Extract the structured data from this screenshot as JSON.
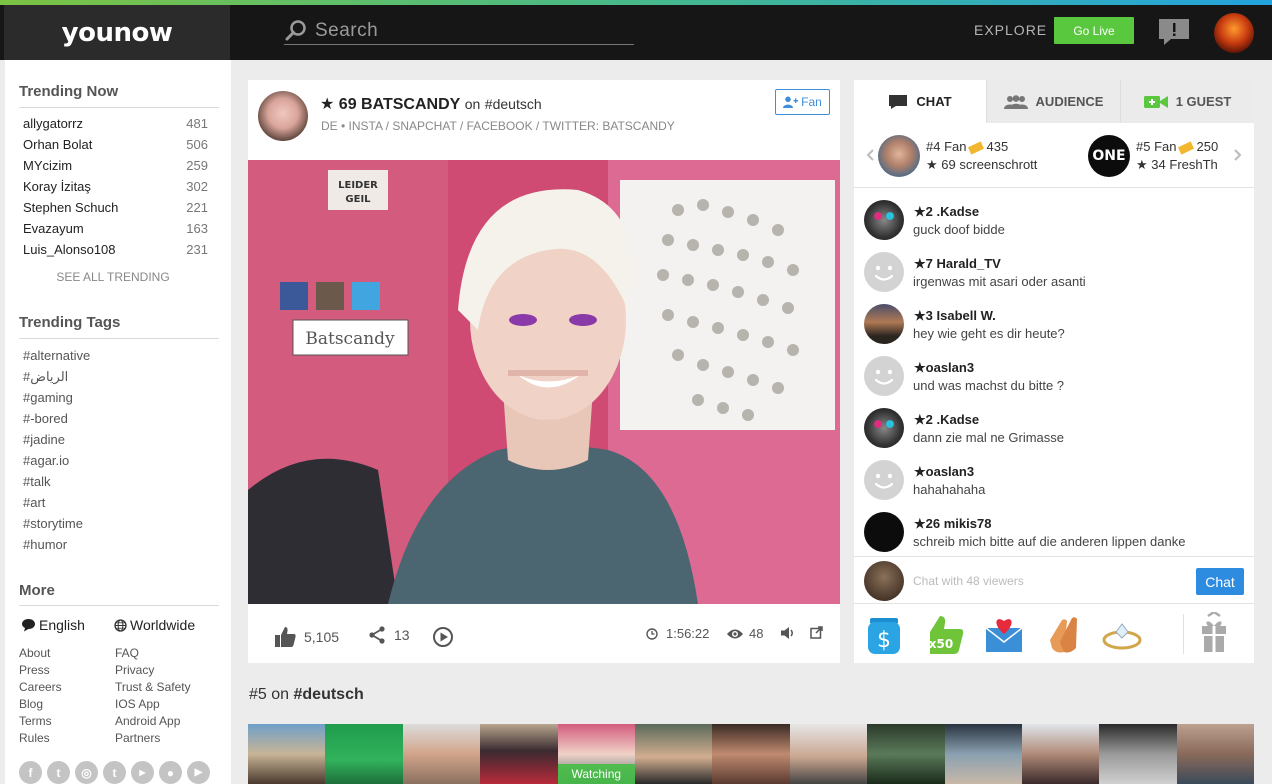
{
  "header": {
    "logo": "younow",
    "search_placeholder": "Search",
    "explore": "EXPLORE",
    "go_live": "Go Live"
  },
  "sidebar": {
    "trending_title": "Trending Now",
    "trending": [
      {
        "name": "allygatorrz",
        "count": "481"
      },
      {
        "name": "Orhan Bolat",
        "count": "506"
      },
      {
        "name": "MYcizim",
        "count": "259"
      },
      {
        "name": "Koray İzitaş",
        "count": "302"
      },
      {
        "name": "Stephen Schuch",
        "count": "221"
      },
      {
        "name": "Evazayum",
        "count": "163"
      },
      {
        "name": "Luis_Alonso108",
        "count": "231"
      }
    ],
    "see_all": "SEE ALL TRENDING",
    "tags_title": "Trending Tags",
    "tags": [
      "#alternative",
      "#الرياض",
      "#gaming",
      "#-bored",
      "#jadine",
      "#agar.io",
      "#talk",
      "#art",
      "#storytime",
      "#humor"
    ],
    "more_title": "More",
    "language": "English",
    "region": "Worldwide",
    "links_left": [
      "About",
      "Press",
      "Careers",
      "Blog",
      "Terms",
      "Rules"
    ],
    "links_right": [
      "FAQ",
      "Privacy",
      "Trust & Safety",
      "IOS App",
      "Android App",
      "Partners"
    ]
  },
  "broadcast": {
    "level": "69",
    "name": "BATSCANDY",
    "on_label": "on",
    "tag": "#deutsch",
    "description": "DE • INSTA / SNAPCHAT / FACEBOOK / TWITTER: BATSCANDY",
    "fan_button": "Fan",
    "likes": "5,105",
    "shares": "13",
    "duration": "1:56:22",
    "viewers": "48",
    "video_signs": {
      "leider": "LEIDER",
      "geil": "GEIL",
      "batscandy": "Batscandy"
    }
  },
  "chat": {
    "tabs": [
      {
        "label": "CHAT",
        "icon": "chat-bubble-icon"
      },
      {
        "label": "AUDIENCE",
        "icon": "audience-icon"
      },
      {
        "label": "1 GUEST",
        "icon": "video-camera-icon"
      }
    ],
    "top_fans": [
      {
        "rank": "#4 Fan",
        "points": "435",
        "level": "69",
        "name": "screenschrott"
      },
      {
        "rank": "#5 Fan",
        "points": "250",
        "level": "34",
        "name": "FreshTh"
      }
    ],
    "one_logo": "ONE",
    "messages": [
      {
        "level": "2",
        "user": ".Kadse",
        "text": "guck doof bidde",
        "avatar": "cat"
      },
      {
        "level": "7",
        "user": "Harald_TV",
        "text": "irgenwas mit asari oder asanti",
        "avatar": "face"
      },
      {
        "level": "3",
        "user": "Isabell W.",
        "text": "hey wie geht es dir heute?",
        "avatar": "sunset"
      },
      {
        "level": "",
        "user": "oaslan3",
        "text": "und was machst du bitte ?",
        "avatar": "face"
      },
      {
        "level": "2",
        "user": ".Kadse",
        "text": "dann zie mal ne Grimasse",
        "avatar": "cat"
      },
      {
        "level": "",
        "user": "oaslan3",
        "text": "hahahahaha",
        "avatar": "face"
      },
      {
        "level": "26",
        "user": "mikis78",
        "text": "schreib mich bitte auf die anderen lippen danke",
        "avatar": "black"
      }
    ],
    "input_placeholder": "Chat with 48 viewers",
    "send_button": "Chat",
    "gift_x50": "x50"
  },
  "bottom": {
    "rank": "#5",
    "on_label": "on",
    "tag": "#deutsch",
    "watching": "Watching"
  },
  "colors": {
    "accent_green": "#5ac83e",
    "accent_blue": "#2d8be0",
    "topbar": "#161616"
  }
}
